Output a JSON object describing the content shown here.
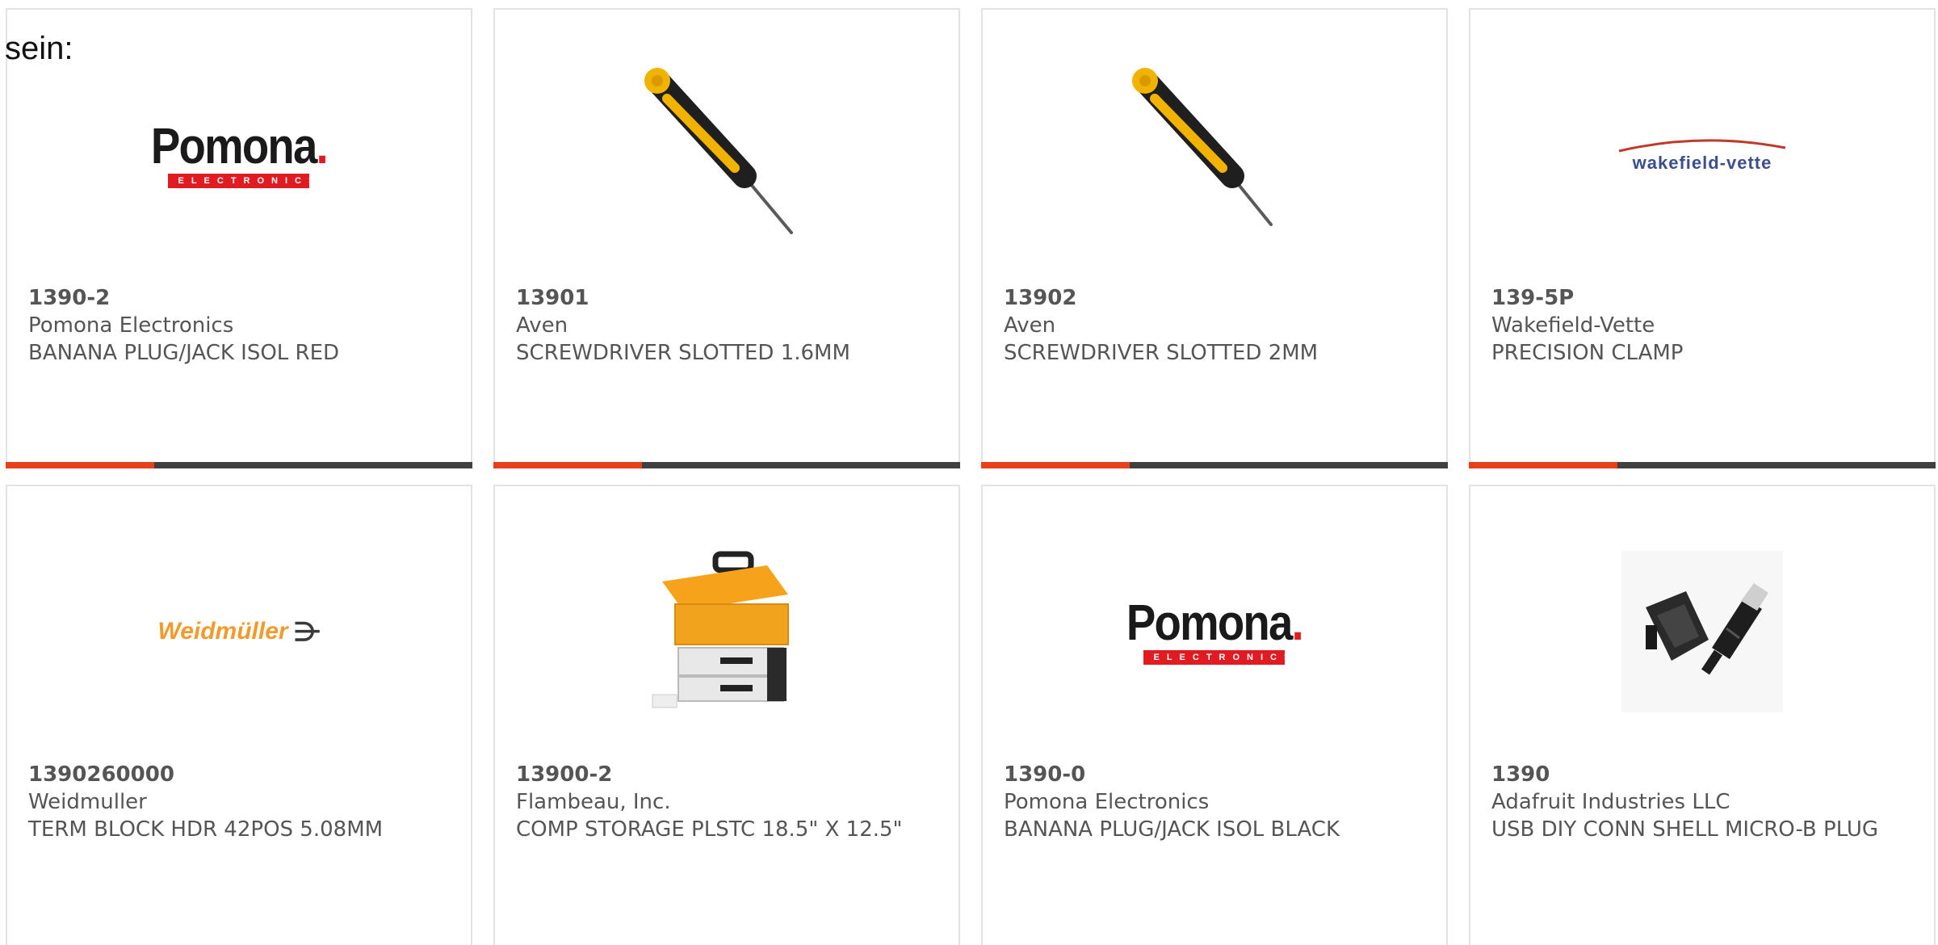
{
  "intro_text": "sein:",
  "colors": {
    "accent": "#e8401c",
    "bar_dark": "#404040",
    "border": "#e3e3e3",
    "text": "#555555"
  },
  "products": [
    {
      "part_number": "1390-2",
      "manufacturer": "Pomona Electronics",
      "description": "BANANA PLUG/JACK ISOL RED",
      "image": "pomona-logo",
      "logo": {
        "word": "Pomona",
        "sub": "ELECTRONICS"
      }
    },
    {
      "part_number": "13901",
      "manufacturer": "Aven",
      "description": "SCREWDRIVER SLOTTED 1.6MM",
      "image": "screwdriver-image"
    },
    {
      "part_number": "13902",
      "manufacturer": "Aven",
      "description": "SCREWDRIVER SLOTTED 2MM",
      "image": "screwdriver-image"
    },
    {
      "part_number": "139-5P",
      "manufacturer": "Wakefield-Vette",
      "description": "PRECISION CLAMP",
      "image": "wakefield-vette-logo",
      "logo": {
        "word": "wakefield-vette"
      }
    },
    {
      "part_number": "1390260000",
      "manufacturer": "Weidmuller",
      "description": "TERM BLOCK HDR 42POS 5.08MM",
      "image": "weidmuller-logo",
      "logo": {
        "word": "Weidmüller"
      }
    },
    {
      "part_number": "13900-2",
      "manufacturer": "Flambeau, Inc.",
      "description": "COMP STORAGE PLSTC 18.5\" X 12.5\"",
      "image": "storage-toolbox-image"
    },
    {
      "part_number": "1390-0",
      "manufacturer": "Pomona Electronics",
      "description": "BANANA PLUG/JACK ISOL BLACK",
      "image": "pomona-logo",
      "logo": {
        "word": "Pomona",
        "sub": "ELECTRONICS"
      }
    },
    {
      "part_number": "1390",
      "manufacturer": "Adafruit Industries LLC",
      "description": "USB DIY CONN SHELL MICRO-B PLUG",
      "image": "usb-connector-shell-image"
    }
  ]
}
